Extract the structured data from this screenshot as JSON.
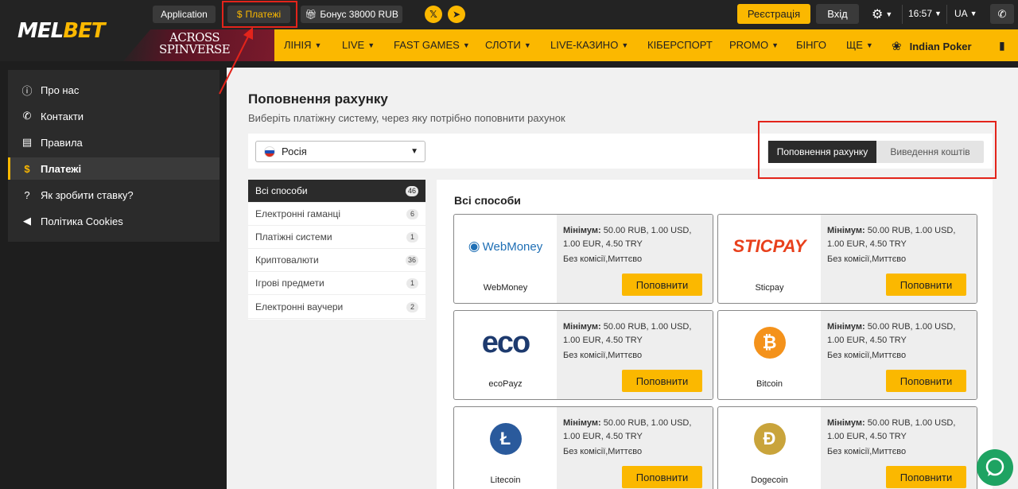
{
  "brand": {
    "part1": "MEL",
    "part2": "BET"
  },
  "topbar": {
    "application": "Application",
    "payments": "Платежі",
    "bonus": "Бонус 38000 RUB",
    "register": "Реєстрація",
    "login": "Вхід",
    "time": "16:57",
    "lang": "UA"
  },
  "promo": {
    "line1": "ACROSS",
    "line2": "SPINVERSE"
  },
  "nav": [
    "ЛІНІЯ",
    "LIVE",
    "FAST GAMES",
    "СЛОТИ",
    "LIVE-КАЗИНО",
    "КІБЕРСПОРТ",
    "PROMO",
    "БІНГО",
    "ЩЕ",
    "Indian Poker"
  ],
  "sidebar": [
    {
      "label": "Про нас",
      "icon": "info-icon"
    },
    {
      "label": "Контакти",
      "icon": "phone-icon"
    },
    {
      "label": "Правила",
      "icon": "document-icon"
    },
    {
      "label": "Платежі",
      "icon": "dollar-icon"
    },
    {
      "label": "Як зробити ставку?",
      "icon": "question-icon"
    },
    {
      "label": "Політика Cookies",
      "icon": "megaphone-icon"
    }
  ],
  "page": {
    "title": "Поповнення рахунку",
    "subtitle": "Виберіть платіжну систему, через яку потрібно поповнити рахунок",
    "country": "Росія",
    "toggle_deposit": "Поповнення рахунку",
    "toggle_withdraw": "Виведення коштів"
  },
  "categories": [
    {
      "label": "Всі способи",
      "count": "46"
    },
    {
      "label": "Електронні гаманці",
      "count": "6"
    },
    {
      "label": "Платіжні системи",
      "count": "1"
    },
    {
      "label": "Криптовалюти",
      "count": "36"
    },
    {
      "label": "Ігрові предмети",
      "count": "1"
    },
    {
      "label": "Електронні ваучери",
      "count": "2"
    }
  ],
  "methods_title": "Всі способи",
  "method_common": {
    "min_label": "Мінімум:",
    "min_value": "50.00 RUB, 1.00 USD, 1.00 EUR, 4.50 TRY",
    "fee": "Без комісії,Миттєво",
    "button": "Поповнити"
  },
  "methods": [
    {
      "name": "WebMoney",
      "logo_text": "WebMoney"
    },
    {
      "name": "Sticpay",
      "logo_text": "STICPAY"
    },
    {
      "name": "ecoPayz",
      "logo_text": "eco"
    },
    {
      "name": "Bitcoin",
      "logo_text": "₿"
    },
    {
      "name": "Litecoin",
      "logo_text": "Ł"
    },
    {
      "name": "Dogecoin",
      "logo_text": "Ð"
    }
  ],
  "colors": {
    "accent": "#fbb800",
    "dark": "#232323",
    "highlight": "#e3241b",
    "chat": "#1ea362"
  }
}
